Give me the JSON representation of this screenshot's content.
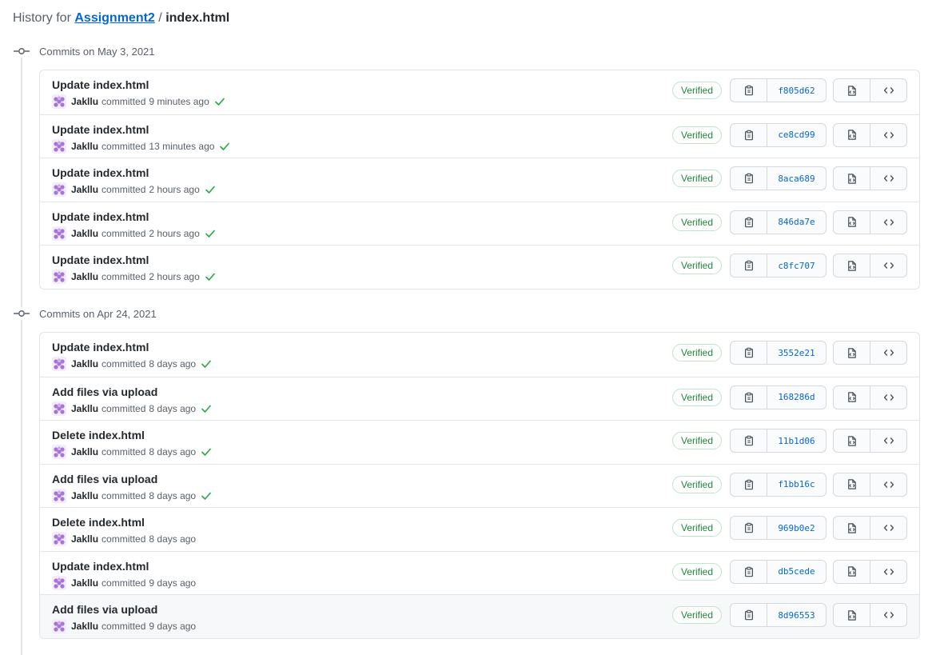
{
  "header": {
    "prefix": "History for",
    "repo": "Assignment2",
    "separator": "/",
    "file": "index.html"
  },
  "groups": [
    {
      "title": "Commits on May 3, 2021",
      "commits": [
        {
          "message": "Update index.html",
          "author": "Jakllu",
          "action": "committed",
          "time": "9 minutes ago",
          "verified": "Verified",
          "sha": "f805d62",
          "check": true
        },
        {
          "message": "Update index.html",
          "author": "Jakllu",
          "action": "committed",
          "time": "13 minutes ago",
          "verified": "Verified",
          "sha": "ce8cd99",
          "check": true
        },
        {
          "message": "Update index.html",
          "author": "Jakllu",
          "action": "committed",
          "time": "2 hours ago",
          "verified": "Verified",
          "sha": "8aca689",
          "check": true
        },
        {
          "message": "Update index.html",
          "author": "Jakllu",
          "action": "committed",
          "time": "2 hours ago",
          "verified": "Verified",
          "sha": "846da7e",
          "check": true
        },
        {
          "message": "Update index.html",
          "author": "Jakllu",
          "action": "committed",
          "time": "2 hours ago",
          "verified": "Verified",
          "sha": "c8fc707",
          "check": true
        }
      ]
    },
    {
      "title": "Commits on Apr 24, 2021",
      "commits": [
        {
          "message": "Update index.html",
          "author": "Jakllu",
          "action": "committed",
          "time": "8 days ago",
          "verified": "Verified",
          "sha": "3552e21",
          "check": true
        },
        {
          "message": "Add files via upload",
          "author": "Jakllu",
          "action": "committed",
          "time": "8 days ago",
          "verified": "Verified",
          "sha": "168286d",
          "check": true
        },
        {
          "message": "Delete index.html",
          "author": "Jakllu",
          "action": "committed",
          "time": "8 days ago",
          "verified": "Verified",
          "sha": "11b1d06",
          "check": true
        },
        {
          "message": "Add files via upload",
          "author": "Jakllu",
          "action": "committed",
          "time": "8 days ago",
          "verified": "Verified",
          "sha": "f1bb16c",
          "check": true
        },
        {
          "message": "Delete index.html",
          "author": "Jakllu",
          "action": "committed",
          "time": "8 days ago",
          "verified": "Verified",
          "sha": "969b0e2",
          "check": false
        },
        {
          "message": "Update index.html",
          "author": "Jakllu",
          "action": "committed",
          "time": "9 days ago",
          "verified": "Verified",
          "sha": "db5cede",
          "check": false
        },
        {
          "message": "Add files via upload",
          "author": "Jakllu",
          "action": "committed",
          "time": "9 days ago",
          "verified": "Verified",
          "sha": "8d96553",
          "check": false,
          "highlighted": true
        }
      ]
    }
  ],
  "icons": {
    "node": "git-commit-icon",
    "avatar": "identicon-avatar",
    "check": "check-icon",
    "copy": "clipboard-icon",
    "browse": "file-code-icon",
    "code": "code-icon"
  },
  "colors": {
    "link": "#0366d6",
    "verified": "#22863a",
    "check": "#28a745",
    "avatar": "#a874d6",
    "border": "#e1e4e8"
  }
}
